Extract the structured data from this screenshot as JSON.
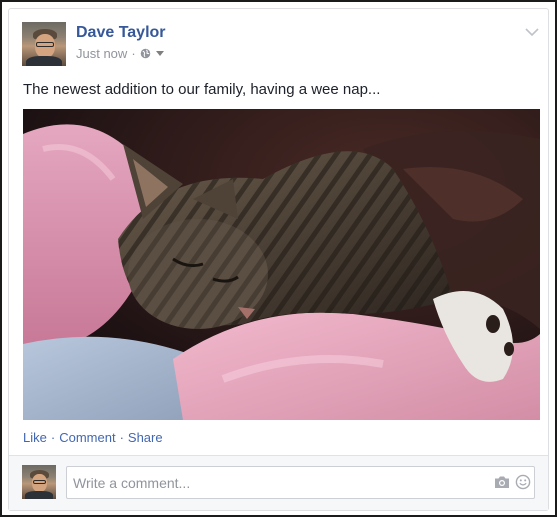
{
  "post": {
    "author": "Dave Taylor",
    "timestamp": "Just now",
    "separator": "·",
    "privacy_icon": "globe-icon",
    "text": "The newest addition to our family, having a wee nap...",
    "photo_subject": "sleeping-kitten-photo"
  },
  "actions": {
    "like": "Like",
    "comment": "Comment",
    "share": "Share",
    "separator": "·"
  },
  "comment_bar": {
    "placeholder": "Write a comment...",
    "camera_icon": "camera-icon",
    "emoji_icon": "smiley-icon"
  },
  "colors": {
    "link": "#4267b2",
    "author": "#365899",
    "meta": "#90949c"
  }
}
